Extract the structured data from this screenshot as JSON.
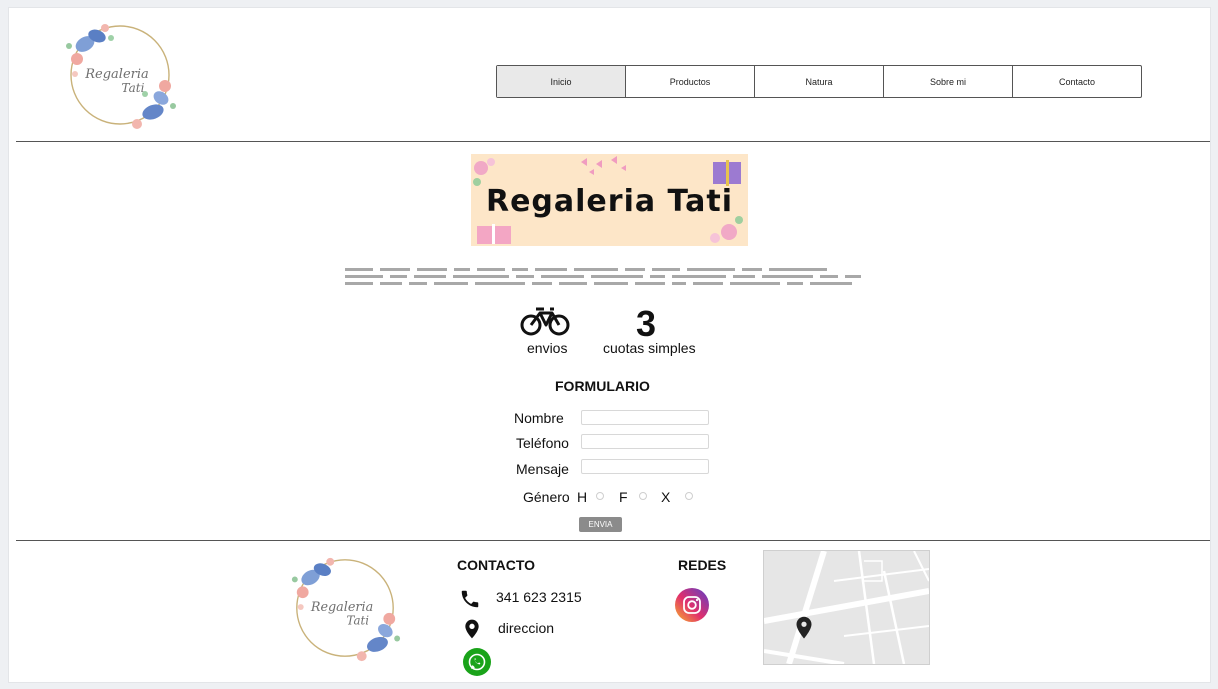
{
  "brand": {
    "logo_text_line1": "Regaleria",
    "logo_text_line2": "Tati"
  },
  "nav": {
    "items": [
      {
        "label": "Inicio",
        "active": true
      },
      {
        "label": "Productos",
        "active": false
      },
      {
        "label": "Natura",
        "active": false
      },
      {
        "label": "Sobre mi",
        "active": false
      },
      {
        "label": "Contacto",
        "active": false
      }
    ]
  },
  "banner": {
    "title": "Regaleria Tati"
  },
  "features": {
    "shipping_label": "envios",
    "installments_number": "3",
    "installments_label": "cuotas simples",
    "icons": [
      "bicycle-icon"
    ]
  },
  "form": {
    "title": "FORMULARIO",
    "name_label": "Nombre",
    "phone_label": "Teléfono",
    "message_label": "Mensaje",
    "gender_label": "Género",
    "gender_options": [
      "H",
      "F",
      "X"
    ],
    "submit_label": "ENVIA",
    "name_value": "",
    "phone_value": "",
    "message_value": ""
  },
  "footer": {
    "contact_heading": "CONTACTO",
    "phone": "341 623 2315",
    "address": "direccion",
    "social_heading": "REDES",
    "icons": [
      "phone-icon",
      "location-pin-icon",
      "whatsapp-icon",
      "instagram-icon",
      "map-pin-icon"
    ]
  },
  "colors": {
    "nav_active_bg": "#e9e9e9",
    "banner_bg": "#fde6c8",
    "submit_bg": "#8b8b8b",
    "whatsapp": "#1aa31a",
    "map_bg": "#e6e6e6"
  }
}
